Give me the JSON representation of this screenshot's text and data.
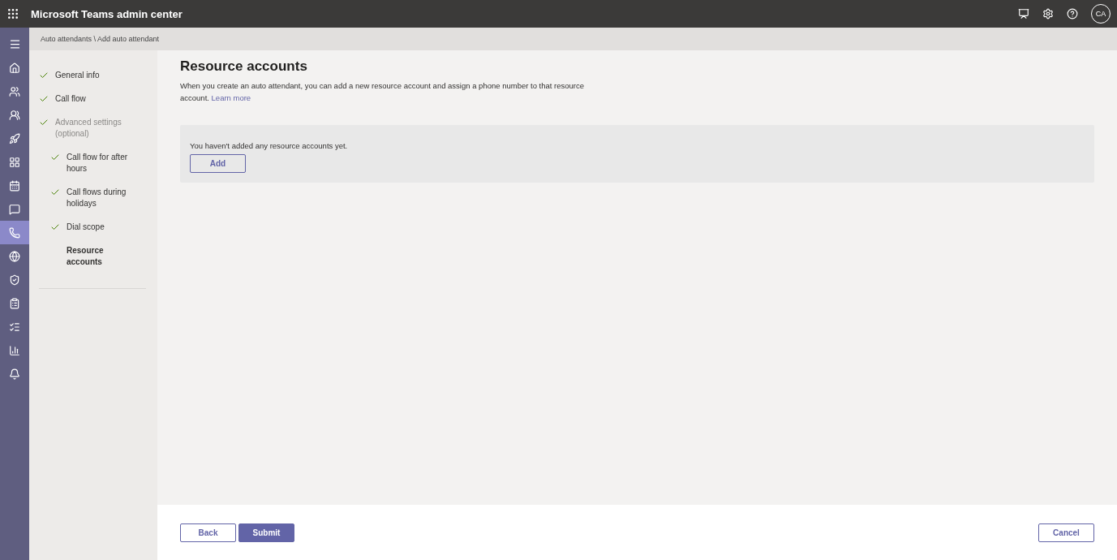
{
  "header": {
    "title": "Microsoft Teams admin center",
    "avatar": "CA"
  },
  "rail": [
    {
      "kind": "home",
      "selected": false
    },
    {
      "kind": "teams",
      "selected": false
    },
    {
      "kind": "users",
      "selected": false
    },
    {
      "kind": "deploy",
      "selected": false
    },
    {
      "kind": "apps",
      "selected": false
    },
    {
      "kind": "meetings",
      "selected": false
    },
    {
      "kind": "messaging",
      "selected": false
    },
    {
      "kind": "voice",
      "selected": true
    },
    {
      "kind": "locations",
      "selected": false
    },
    {
      "kind": "security",
      "selected": false
    },
    {
      "kind": "planning",
      "selected": false
    },
    {
      "kind": "tasks",
      "selected": false
    },
    {
      "kind": "analytics",
      "selected": false
    },
    {
      "kind": "notifications",
      "selected": false
    }
  ],
  "breadcrumb": "Auto attendants \\ Add auto attendant",
  "steps": [
    {
      "label": "General info",
      "completed": true,
      "current": false,
      "disabled": false
    },
    {
      "label": "Call flow",
      "completed": true,
      "current": false,
      "disabled": false
    },
    {
      "label": "Advanced settings (optional)",
      "completed": true,
      "current": false,
      "disabled": true,
      "children": [
        {
          "label": "Call flow for after hours",
          "completed": true,
          "current": false,
          "disabled": false
        },
        {
          "label": "Call flows during holidays",
          "completed": true,
          "current": false,
          "disabled": false
        },
        {
          "label": "Dial scope",
          "completed": true,
          "current": false,
          "disabled": false
        },
        {
          "label": "Resource accounts",
          "completed": false,
          "current": true,
          "disabled": false
        }
      ]
    }
  ],
  "page": {
    "title": "Resource accounts",
    "description": "When you create an auto attendant, you can add a new resource account and assign a phone number to that resource account.",
    "link": "Learn more"
  },
  "empty_panel": {
    "message": "You haven't added any resource accounts yet.",
    "button": "Add"
  },
  "footer": {
    "back": "Back",
    "submit": "Submit",
    "cancel": "Cancel"
  }
}
